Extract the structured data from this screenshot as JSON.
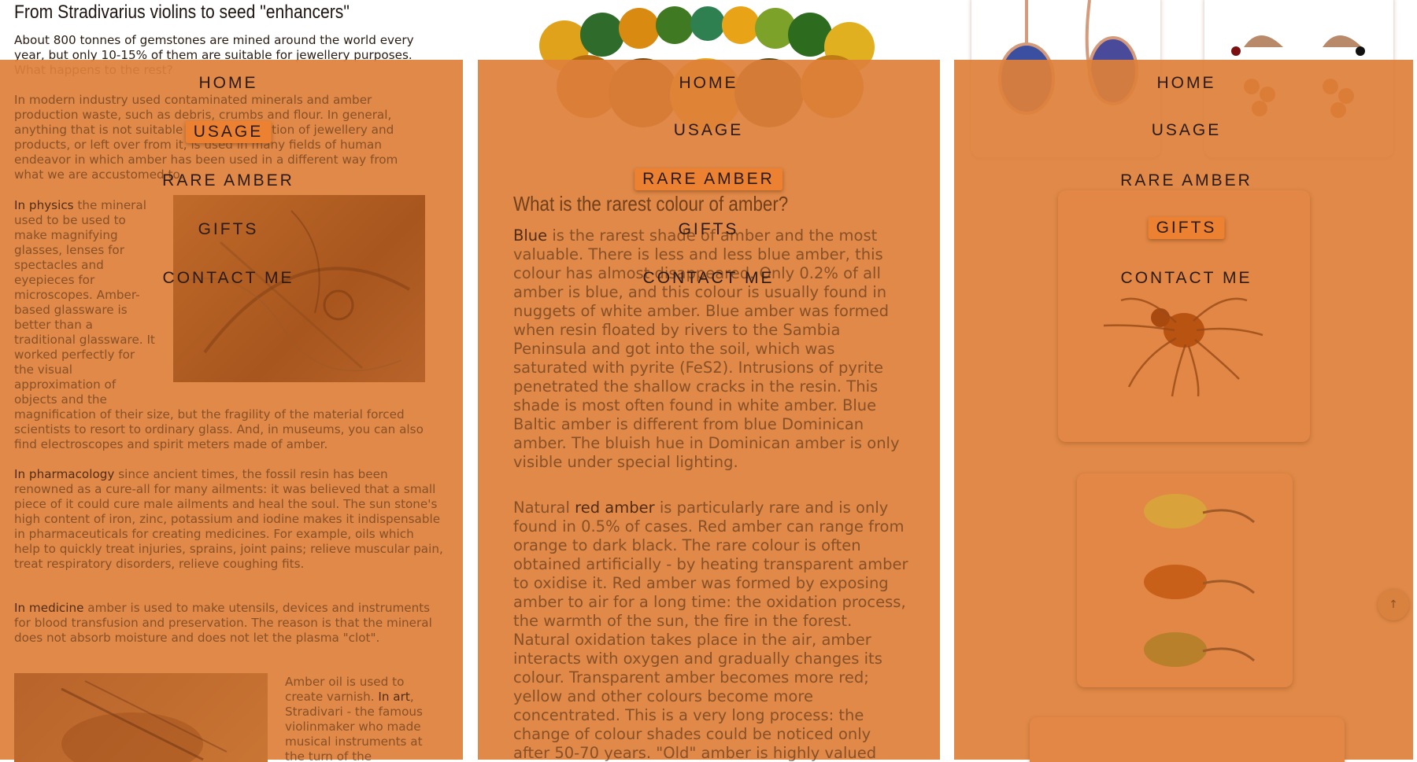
{
  "panel1": {
    "title": "From Stradivarius violins to seed \"enhancers\"",
    "intro": "About 800 tonnes of gemstones are mined around the world every year, but only 10-15% of them are suitable for jewellery purposes. What happens to the rest?",
    "para_industry": "In modern industry used contaminated minerals and amber production waste, such as debris, crumbs and flour. In general, anything that is not suitable for the production of jewellery and products, or left over from it, is used in many fields of human endeavor in which amber has been used in a different way from what we are accustomed to.",
    "physics_label": "In physics",
    "physics_text": " the mineral used to be used to make magnifying glasses, lenses for spectacles and eyepieces for microscopes. Amber-based glassware is better than a traditional glassware. It worked perfectly for the visual approximation of objects and the",
    "physics_continued": "magnification of their size, but the fragility of the material forced scientists to resort to ordinary glass. And, in museums, you can also find electroscopes and spirit meters made of amber.",
    "pharmacology_label": "In pharmacology",
    "pharmacology_text": " since ancient times, the fossil resin has been renowned as a cure-all for many ailments: it was believed that a small piece of it could cure male ailments and heal the soul. The sun stone's high content of iron, zinc, potassium and iodine makes it indispensable in pharmaceuticals for creating medicines. For example, oils which help to quickly treat injuries, sprains, joint pains; relieve muscular pain, treat respiratory disorders, relieve coughing fits.",
    "medicine_label": "In medicine",
    "medicine_text": " amber is used to make utensils, devices and instruments for blood transfusion and preservation. The reason is that the mineral does not absorb moisture and does not let the plasma \"clot\".",
    "art_before": "Amber oil is used to create varnish. ",
    "art_label": "In art",
    "art_after": ", Stradivari - the famous violinmaker who made musical instruments at the turn of the"
  },
  "panel2": {
    "heading": "What is the rarest colour of amber?",
    "blue_label": "Blue",
    "blue_text": " is the rarest shade of amber and the most valuable. There is less and less blue amber, this colour has almost disappeared. Only 0.2% of all amber is blue, and this colour is usually found in nuggets of white amber. Blue amber was formed when resin floated by rivers to the Sambia Peninsula and got into the soil, which was saturated with pyrite (FeS2). Intrusions of pyrite penetrated the shallow cracks in the resin. This shade is most often found in white amber. Blue Baltic amber is different from blue Dominican amber. The bluish hue in Dominican amber is only visible under special lighting.",
    "red_before": "Natural ",
    "red_label": "red amber",
    "red_text": " is particularly rare and is only found in 0.5% of cases. Red amber can range from orange to dark black. The rare colour is often obtained artificially - by heating transparent amber to oxidise it. Red amber was formed by exposing amber to air for a long time: the oxidation process, the warmth of the sun, the fire in the forest. Natural oxidation takes place in the air, amber interacts with oxygen and gradually changes its colour. Transparent amber becomes more red; yellow and other colours become more concentrated. This is a very long process: the change of colour shades could be noticed only after 50-70 years. \"Old\" amber is highly valued because of its \"maturity\" and has its"
  },
  "nav": {
    "items": [
      "HOME",
      "USAGE",
      "RARE AMBER",
      "GIFTS",
      "CONTACT ME"
    ],
    "active_panel1": "USAGE",
    "active_panel2": "RARE AMBER",
    "active_panel3": "GIFTS"
  },
  "scroll_top": {
    "icon": "arrow-up-icon",
    "glyph": "↑"
  },
  "colors": {
    "overlay": "#de803a",
    "active_nav": "#eb8131",
    "text_dark": "#2a1a10"
  }
}
